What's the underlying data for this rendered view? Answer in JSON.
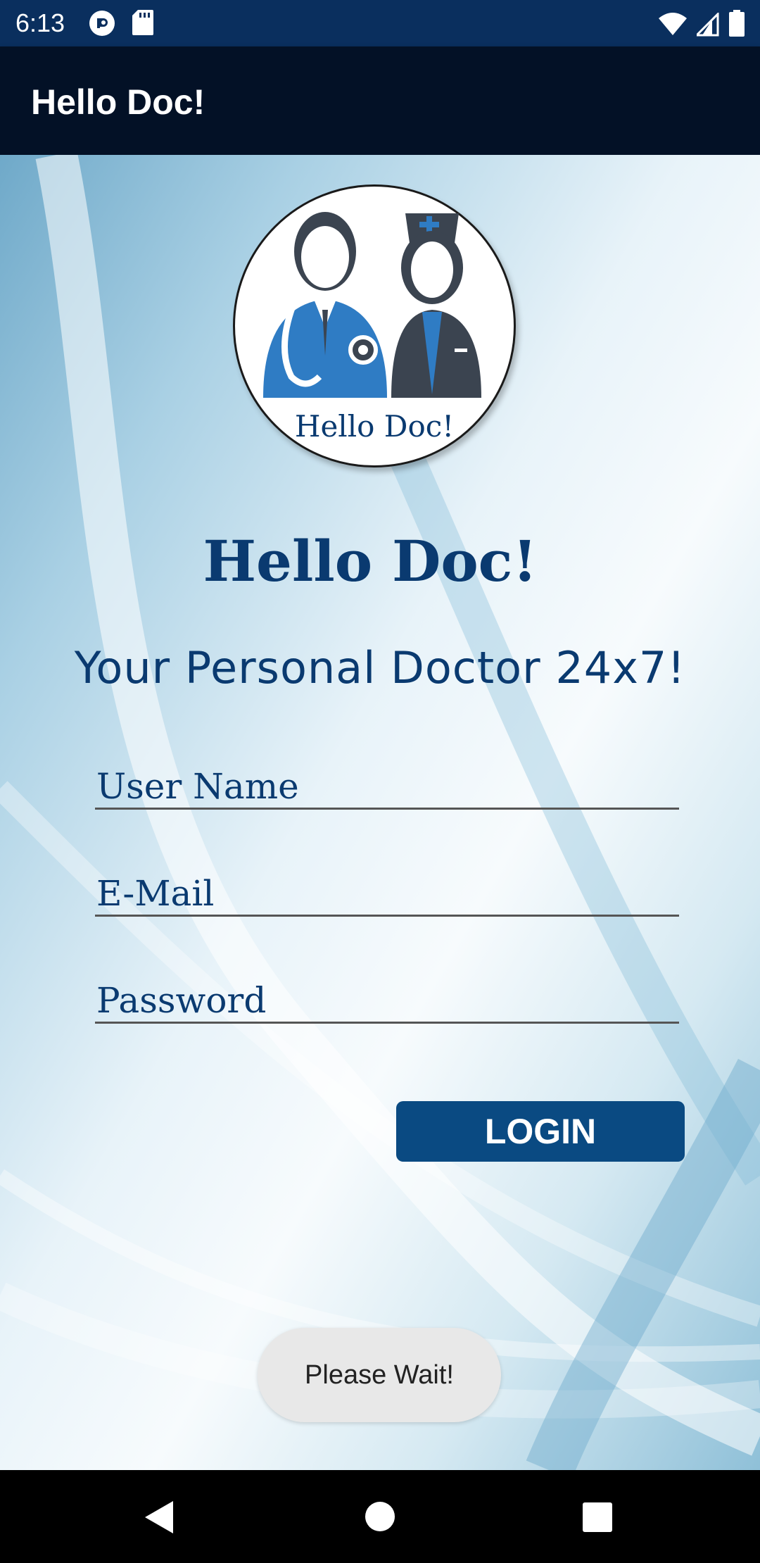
{
  "status_bar": {
    "time": "6:13",
    "left_icons": [
      "pocket-casts-icon",
      "sd-card-icon"
    ],
    "right_icons": [
      "wifi-icon",
      "cell-signal-icon",
      "battery-icon"
    ]
  },
  "app_bar": {
    "title": "Hello Doc!"
  },
  "logo": {
    "text": "Hello Doc!"
  },
  "main": {
    "title": "Hello Doc!",
    "subtitle": "Your Personal Doctor 24x7!"
  },
  "form": {
    "username_placeholder": "User Name",
    "email_placeholder": "E-Mail",
    "password_placeholder": "Password",
    "login_label": "LOGIN"
  },
  "toast": {
    "text": "Please Wait!"
  },
  "nav_bar": {
    "icons": [
      "back-icon",
      "home-icon",
      "recents-icon"
    ]
  },
  "colors": {
    "status_bar": "#0a2f5e",
    "app_bar": "#031126",
    "primary_text": "#0a3a70",
    "button": "#0a4a82",
    "logo_blue": "#2f7cc4",
    "logo_dark": "#3b4450"
  }
}
